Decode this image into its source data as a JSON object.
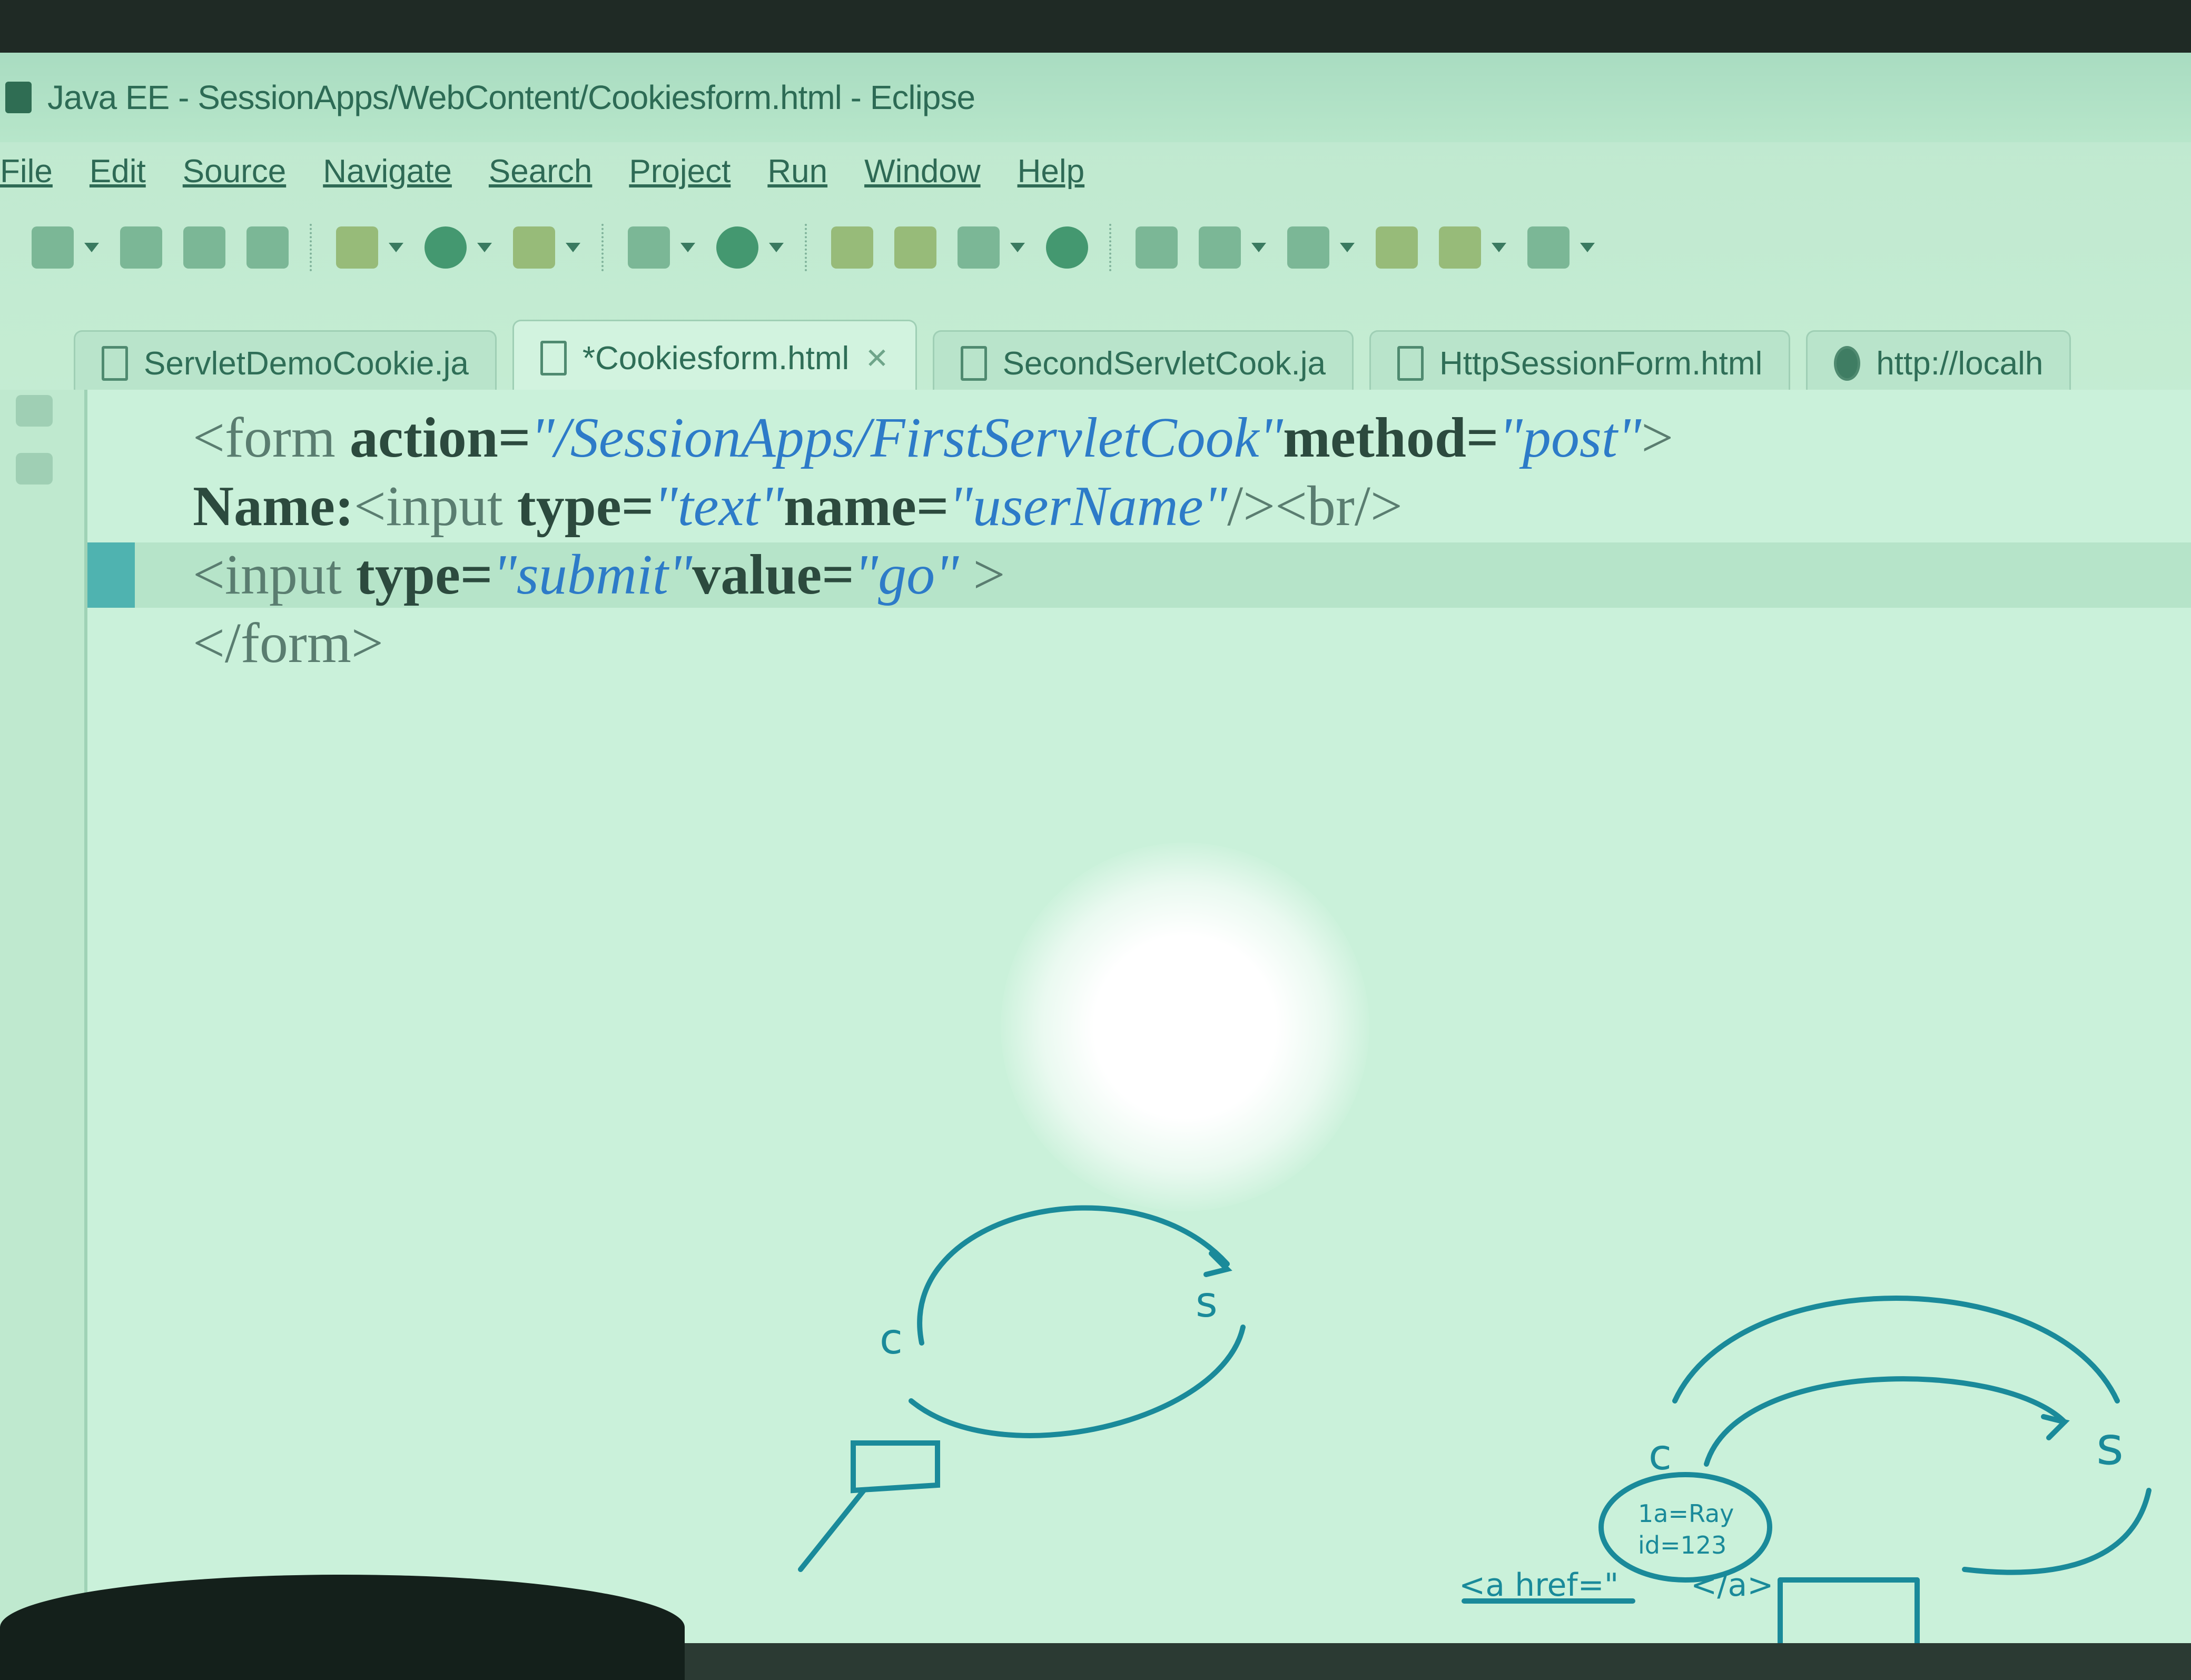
{
  "window": {
    "title": "Java EE - SessionApps/WebContent/Cookiesform.html - Eclipse"
  },
  "menu": {
    "items": [
      "File",
      "Edit",
      "Source",
      "Navigate",
      "Search",
      "Project",
      "Run",
      "Window",
      "Help"
    ]
  },
  "tabs": [
    {
      "label": "ServletDemoCookie.ja",
      "icon": "java-file-icon"
    },
    {
      "label": "*Cookiesform.html",
      "icon": "html-file-icon",
      "close": "✕"
    },
    {
      "label": "SecondServletCook.ja",
      "icon": "java-file-icon"
    },
    {
      "label": "HttpSessionForm.html",
      "icon": "html-file-icon"
    },
    {
      "label": "http://localh",
      "icon": "globe-icon"
    }
  ],
  "editor": {
    "line1": {
      "open": "<form ",
      "attr1": "action=",
      "val1": "\"/SessionApps/FirstServletCook\"",
      "attr2": "method=",
      "val2": "\"post\"",
      "close": ">"
    },
    "line2": {
      "label": "Name:",
      "open": "<input ",
      "attr1": "type=",
      "val1": "\"text\"",
      "attr2": "name=",
      "val2": "\"userName\"",
      "close": "/><br/>"
    },
    "line3": {
      "open": "<input ",
      "attr1": "type=",
      "val1": "\"submit\"",
      "attr2": "value=",
      "val2": "\"go\"",
      "close": " >"
    },
    "line4": {
      "text": "</form>"
    }
  },
  "annotations": {
    "left": {
      "c": "c",
      "s": "s"
    },
    "right": {
      "c": "c",
      "s": "s",
      "note1": "1a=Ray",
      "note2": "id=123",
      "tag": "<a href=\"",
      "tag_end": "</a>"
    }
  }
}
